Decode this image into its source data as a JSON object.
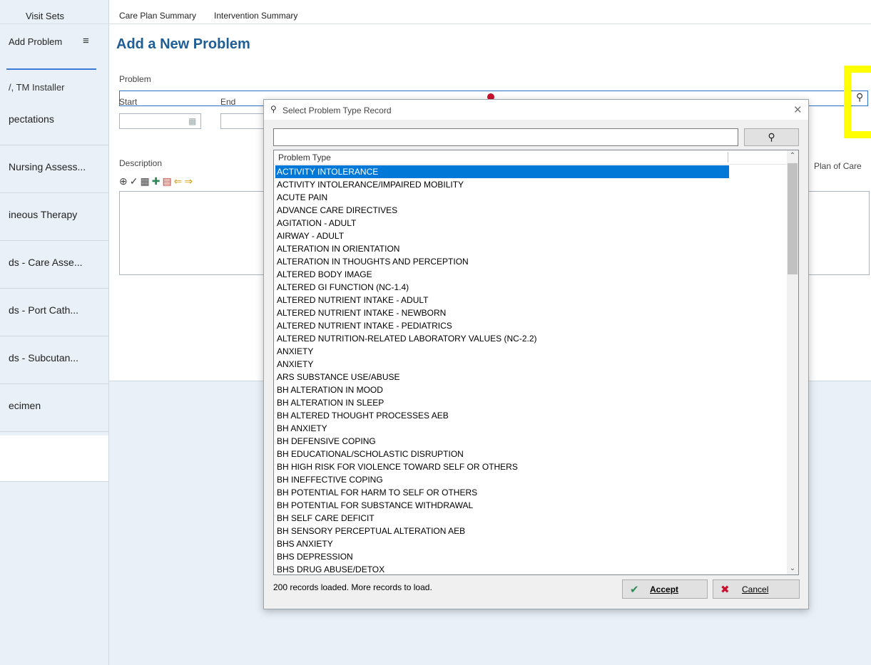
{
  "topbar": {
    "visit_sets": "Visit Sets",
    "tabs": [
      "Care Plan Summary",
      "Intervention Summary"
    ]
  },
  "sidebar": {
    "add_problem": "Add Problem",
    "user": "/, TM Installer",
    "items": [
      "pectations",
      "Nursing Assess...",
      "ineous Therapy",
      "ds - Care Asse...",
      "ds - Port Cath...",
      "ds - Subcutan...",
      "ecimen"
    ]
  },
  "form": {
    "title": "Add a New Problem",
    "problem_label": "Problem",
    "start_label": "Start",
    "end_label": "End",
    "description_label": "Description",
    "right_label": "Plan of Care"
  },
  "dialog": {
    "title": "Select Problem Type Record",
    "column_header": "Problem Type",
    "rows": [
      "ACTIVITY INTOLERANCE",
      "ACTIVITY INTOLERANCE/IMPAIRED MOBILITY",
      "ACUTE PAIN",
      "ADVANCE CARE DIRECTIVES",
      "AGITATION - ADULT",
      "AIRWAY - ADULT",
      "ALTERATION IN ORIENTATION",
      "ALTERATION IN THOUGHTS AND PERCEPTION",
      "ALTERED BODY IMAGE",
      "ALTERED GI FUNCTION (NC-1.4)",
      "ALTERED NUTRIENT INTAKE - ADULT",
      "ALTERED NUTRIENT INTAKE - NEWBORN",
      "ALTERED NUTRIENT INTAKE - PEDIATRICS",
      "ALTERED NUTRITION-RELATED LABORATORY VALUES (NC-2.2)",
      "ANXIETY",
      "ANXIETY",
      "ARS SUBSTANCE USE/ABUSE",
      "BH ALTERATION IN MOOD",
      "BH ALTERATION IN SLEEP",
      "BH ALTERED THOUGHT PROCESSES AEB",
      "BH ANXIETY",
      "BH DEFENSIVE COPING",
      "BH EDUCATIONAL/SCHOLASTIC DISRUPTION",
      "BH HIGH RISK FOR VIOLENCE TOWARD SELF OR OTHERS",
      "BH INEFFECTIVE COPING",
      "BH POTENTIAL FOR HARM TO SELF OR OTHERS",
      "BH POTENTIAL FOR SUBSTANCE WITHDRAWAL",
      "BH SELF CARE DEFICIT",
      "BH SENSORY PERCEPTUAL ALTERATION AEB",
      "BHS ANXIETY",
      "BHS DEPRESSION",
      "BHS DRUG ABUSE/DETOX"
    ],
    "selected_row": 0,
    "status": "200 records loaded. More records to load.",
    "accept_label": "Accept",
    "cancel_label": "Cancel"
  },
  "colors": {
    "accent": "#1f5d95",
    "selection": "#0078d7",
    "highlight": "#ffff00",
    "sidebar_bg": "#e9f0f7",
    "accept_icon": "#2e8b57",
    "cancel_icon": "#c8102e"
  },
  "icons": [
    "menu-icon",
    "search-icon",
    "calendar-icon",
    "close-icon",
    "checkmark-icon",
    "x-icon",
    "required-indicator-icon"
  ]
}
